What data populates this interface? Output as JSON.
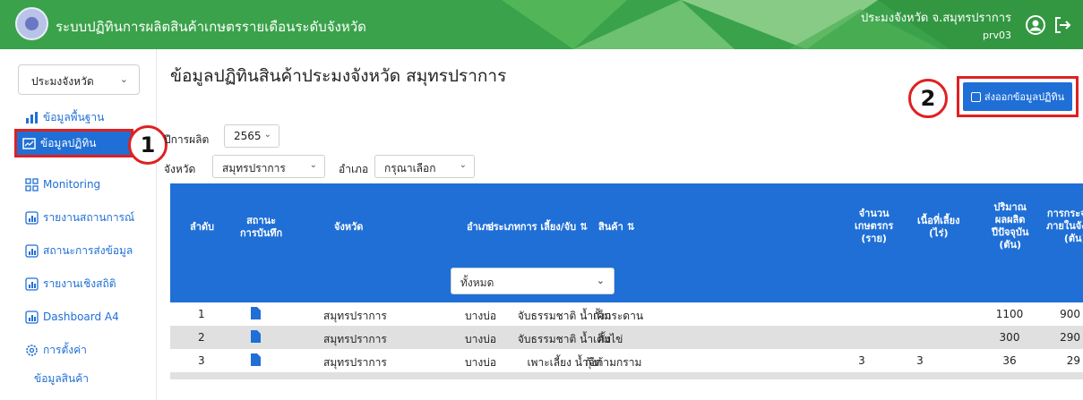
{
  "header": {
    "title": "ระบบปฏิทินการผลิตสินค้าเกษตรรายเดือนระดับจังหวัด",
    "user_name": "ประมงจังหวัด จ.สมุทรปราการ",
    "user_code": "prv03",
    "icons": [
      "user-circle-icon",
      "logout-icon"
    ]
  },
  "sidebar": {
    "role_select": "ประมงจังหวัด",
    "items": [
      {
        "label": "ข้อมูลพื้นฐาน",
        "icon": "bar-chart-icon"
      },
      {
        "label": "ข้อมูลปฏิทิน",
        "icon": "calendar-chart-icon",
        "active": true
      },
      {
        "label": "Monitoring",
        "icon": "grid-icon"
      },
      {
        "label": "รายงานสถานการณ์",
        "icon": "report-icon"
      },
      {
        "label": "สถานะการส่งข้อมูล",
        "icon": "report-icon"
      },
      {
        "label": "รายงานเชิงสถิติ",
        "icon": "report-icon"
      },
      {
        "label": "Dashboard A4",
        "icon": "report-icon"
      },
      {
        "label": "การตั้งค่า",
        "icon": "gear-icon"
      }
    ],
    "sub_items": [
      "ข้อมูลสินค้า"
    ]
  },
  "annotations": {
    "one": "1",
    "two": "2"
  },
  "main": {
    "title": "ข้อมูลปฏิทินสินค้าประมงจังหวัด สมุทรปราการ",
    "export_label": "ส่งออกข้อมูลปฏิทิน",
    "filters": {
      "year_label": "ปีการผลิต",
      "year_value": "2565",
      "province_label": "จังหวัด",
      "province_value": "สมุทรปราการ",
      "district_label": "อำเภอ",
      "district_value": "กรุณาเลือก"
    }
  },
  "table": {
    "headers": {
      "index": "ลำดับ",
      "status_l1": "สถานะ",
      "status_l2": "การบันทึก",
      "province": "จังหวัด",
      "district": "อำเภอ",
      "product": "สินค้า ⇅",
      "type": "ประเภทการ เลี้ยง/จับ ⇅",
      "farmers_l1": "จำนวน",
      "farmers_l2": "เกษตรกร",
      "farmers_l3": "(ราย)",
      "area_l1": "เนื้อที่เลี้ยง",
      "area_l2": "(ไร่)",
      "output_l1": "ปริมาณ",
      "output_l2": "ผลผลิต",
      "output_l3": "ปีปัจจุบัน",
      "output_l4": "(ตัน)",
      "dist_l1": "การกระจ",
      "dist_l2": "ภายในจัง",
      "dist_l3": "(ตัน)"
    },
    "type_filter": "ทั้งหมด",
    "rows": [
      {
        "index": "1",
        "province": "สมุทรปราการ",
        "district": "บางบ่อ",
        "product": "กั้งกระดาน",
        "type": "จับธรรมชาติ น้ำเค็ม",
        "farmers": "",
        "area": "",
        "output": "1100",
        "dist": "900"
      },
      {
        "index": "2",
        "province": "สมุทรปราการ",
        "district": "บางบ่อ",
        "product": "กั้งไข่",
        "type": "จับธรรมชาติ น้ำเค็ม",
        "farmers": "",
        "area": "",
        "output": "300",
        "dist": "290"
      },
      {
        "index": "3",
        "province": "สมุทรปราการ",
        "district": "บางบ่อ",
        "product": "กุ้งก้ามกราม",
        "type": "เพาะเลี้ยง น้ำจืด",
        "farmers": "3",
        "area": "3",
        "output": "36",
        "dist": "29"
      }
    ]
  },
  "colors": {
    "header_green": "#3aa24a",
    "primary_blue": "#1f6fd6",
    "highlight_red": "#e02020"
  }
}
